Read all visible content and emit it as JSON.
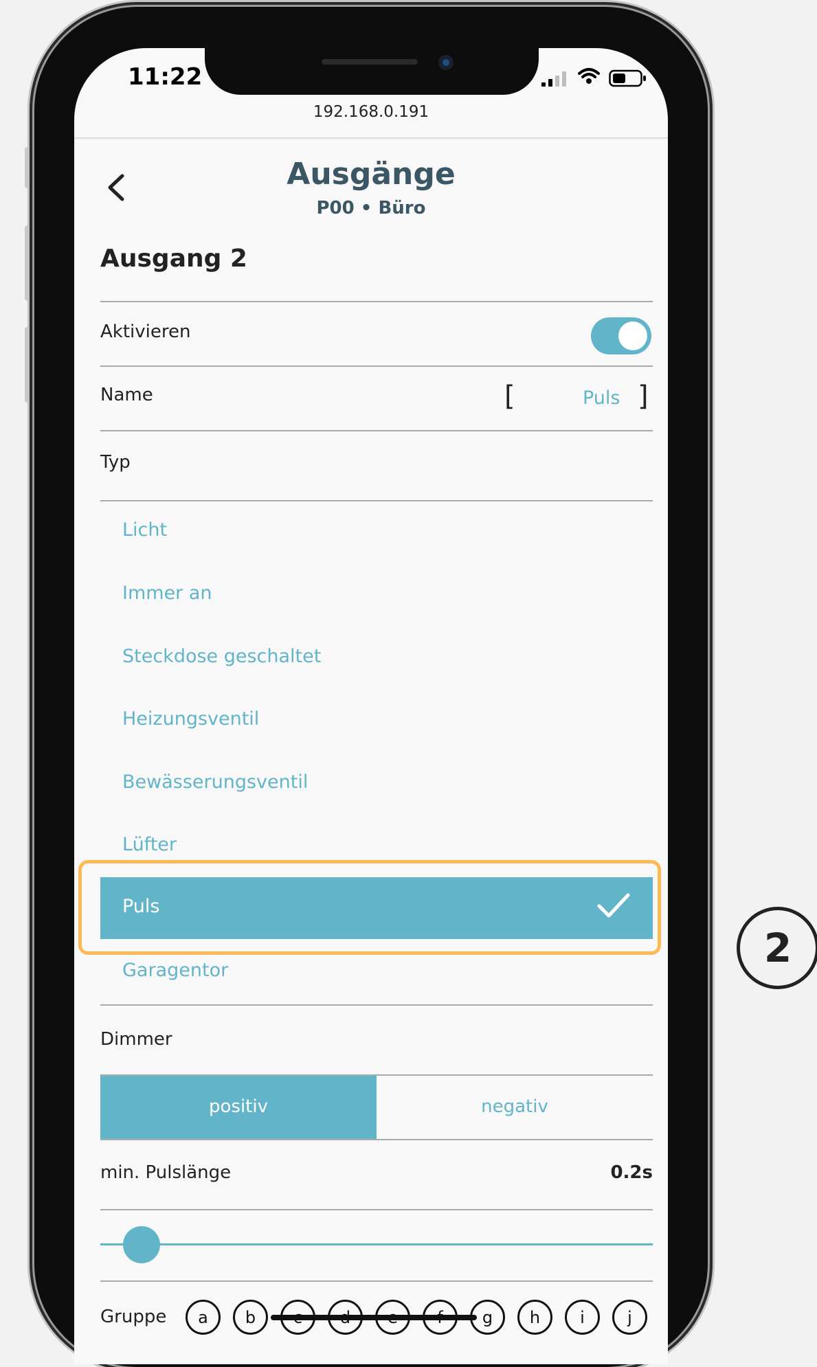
{
  "status_bar": {
    "time": "11:22"
  },
  "browser": {
    "url": "192.168.0.191"
  },
  "header": {
    "title": "Ausgänge",
    "subtitle": "P00 • Büro"
  },
  "section": {
    "title": "Ausgang 2"
  },
  "settings": {
    "activate_label": "Aktivieren",
    "activate_on": true,
    "name_label": "Name",
    "name_open_bracket": "[",
    "name_value": "Puls",
    "name_close_bracket": "]",
    "type_label": "Typ"
  },
  "type_options": [
    "Licht",
    "Immer an",
    "Steckdose geschaltet",
    "Heizungsventil",
    "Bewässerungsventil",
    "Lüfter",
    "Puls",
    "Garagentor"
  ],
  "dimmer": {
    "label": "Dimmer",
    "positive_label": "positiv",
    "negative_label": "negativ",
    "selected": "positiv"
  },
  "pulse": {
    "label": "min. Pulslänge",
    "value": "0.2s",
    "slider_fraction": 0.05
  },
  "group": {
    "label": "Gruppe",
    "options": [
      "a",
      "b",
      "c",
      "d",
      "e",
      "f",
      "g",
      "h",
      "i",
      "j"
    ]
  },
  "annotation": {
    "number": "2"
  },
  "colors": {
    "accent": "#62b5c9",
    "highlight": "#fbba55",
    "title": "#3b5664"
  },
  "icons": {
    "back": "chevron-left-icon",
    "check": "check-icon",
    "wifi": "wifi-icon",
    "battery": "battery-icon",
    "signal": "signal-icon"
  }
}
